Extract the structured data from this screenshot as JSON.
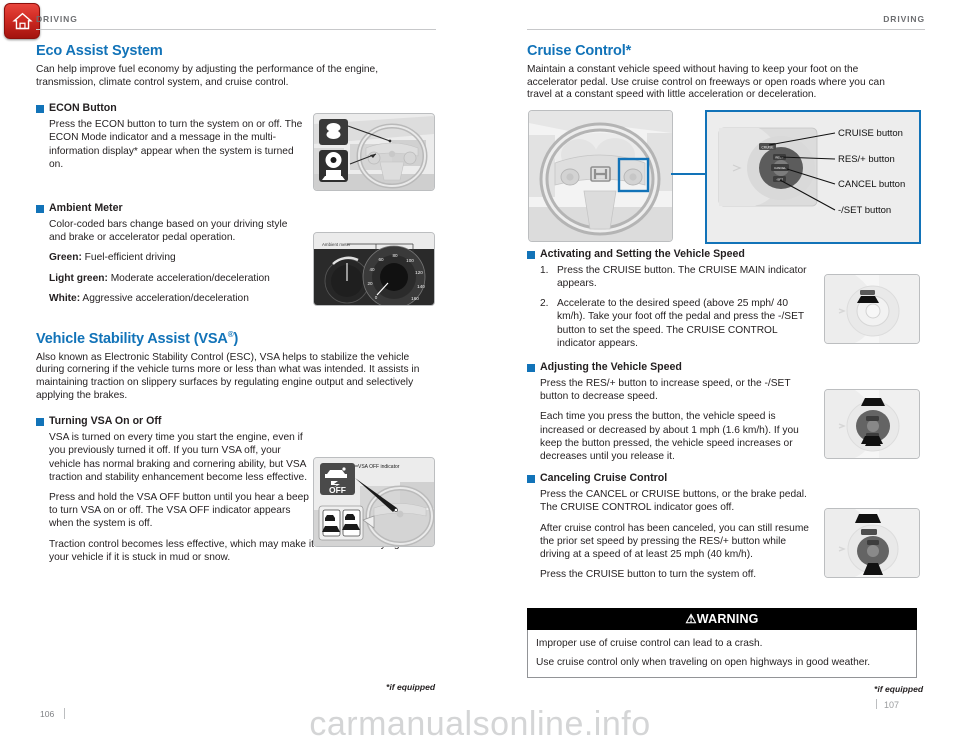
{
  "meta": {
    "home_icon": "home-icon",
    "watermark": "carmanualsonline.info"
  },
  "left_page": {
    "running_head": "DRIVING",
    "page_number": "106",
    "footnote": "*if equipped",
    "sections": [
      {
        "title": "Eco Assist System",
        "intro": "Can help improve fuel economy by adjusting the performance of the engine, transmission, climate control system, and cruise control.",
        "subsections": [
          {
            "heading": "ECON Button",
            "paragraphs": [
              "Press the ECON button to turn the system on or off. The ECON Mode indicator and a message in the multi-information display* appear when the system is turned on."
            ],
            "figure": {
              "name": "econ-button-steering-wheel-figure",
              "labels": []
            }
          },
          {
            "heading": "Ambient Meter",
            "paragraphs": [
              "Color-coded bars change based on your driving style and brake or accelerator pedal operation."
            ],
            "definitions": [
              {
                "term": "Green:",
                "desc": " Fuel-efficient driving"
              },
              {
                "term": "Light green:",
                "desc": " Moderate acceleration/deceleration"
              },
              {
                "term": "White:",
                "desc": " Aggressive acceleration/deceleration"
              }
            ],
            "figure": {
              "name": "ambient-meter-gauge-figure",
              "callout": "Ambient meter",
              "speed_ticks": [
                "0",
                "20",
                "40",
                "60",
                "80",
                "100",
                "120",
                "140",
                "160"
              ]
            }
          }
        ]
      },
      {
        "title": "Vehicle Stability Assist (VSA",
        "title_sup": "®",
        "title_tail": ")",
        "intro": "Also known as Electronic Stability Control (ESC), VSA helps to stabilize the vehicle during cornering if the vehicle turns more or less than what was intended. It assists in maintaining traction on slippery surfaces by regulating engine output and selectively applying the brakes.",
        "subsections": [
          {
            "heading": "Turning VSA On or Off",
            "paragraphs": [
              "VSA is turned on every time you start the engine, even if you previously turned it off. If you turn VSA off, your vehicle has normal braking and cornering ability, but VSA traction and stability enhancement become less effective.",
              "Press and hold the VSA OFF button until you hear a beep to turn VSA on or off. The VSA OFF indicator appears when the system is off.",
              "Traction control becomes less effective, which may make it easier when trying to free your vehicle if it is stuck in mud or snow."
            ],
            "figure": {
              "name": "vsa-off-button-figure",
              "callout": "VSA OFF indicator",
              "button_label": "OFF"
            }
          }
        ]
      }
    ]
  },
  "right_page": {
    "running_head": "DRIVING",
    "page_number": "107",
    "footnote": "*if equipped",
    "section": {
      "title": "Cruise Control*",
      "intro": "Maintain a constant vehicle speed without having to keep your foot on the accelerator pedal. Use cruise control on freeways or open roads where you can travel at a constant speed with little acceleration or deceleration.",
      "hero_figures": {
        "steering_wheel": {
          "name": "steering-wheel-photo-figure"
        },
        "detail_panel": {
          "name": "cruise-control-switch-detail-figure",
          "callouts": [
            "CRUISE button",
            "RES/+ button",
            "CANCEL button",
            "-/SET button"
          ]
        }
      },
      "subsections": [
        {
          "heading": "Activating and Setting the Vehicle Speed",
          "steps": [
            "Press the CRUISE button. The CRUISE MAIN indicator appears.",
            "Accelerate to the desired speed (above 25 mph/ 40 km/h). Take your foot off the pedal and press the -/SET button to set the speed. The CRUISE CONTROL indicator appears."
          ],
          "figure": {
            "name": "cruise-button-press-figure"
          }
        },
        {
          "heading": "Adjusting the Vehicle Speed",
          "paragraphs": [
            "Press the RES/+ button to increase speed, or the -/SET button to decrease speed.",
            "Each time you press the button, the vehicle speed is increased or decreased by about 1 mph (1.6 km/h). If you keep the button pressed, the vehicle speed increases or decreases until you release it."
          ],
          "figure": {
            "name": "res-set-button-press-figure"
          }
        },
        {
          "heading": "Canceling Cruise Control",
          "paragraphs": [
            "Press the CANCEL or CRUISE buttons, or the brake pedal. The CRUISE CONTROL indicator goes off.",
            "After cruise control has been canceled, you can still resume the prior set speed by pressing the RES/+ button while driving at a speed of at least 25 mph (40 km/h).",
            "Press the CRUISE button to turn the system off."
          ],
          "figure": {
            "name": "cancel-cruise-button-press-figure"
          }
        }
      ],
      "warning": {
        "title": "⚠WARNING",
        "lines": [
          "Improper use of cruise control can lead to a crash.",
          "Use cruise control only when traveling on open highways in good weather."
        ]
      }
    }
  },
  "colors": {
    "heading_blue": "#1273b8",
    "bullet_blue": "#1273b8",
    "runhead_gray": "#6d6e71",
    "warning_bar": "#000000"
  }
}
